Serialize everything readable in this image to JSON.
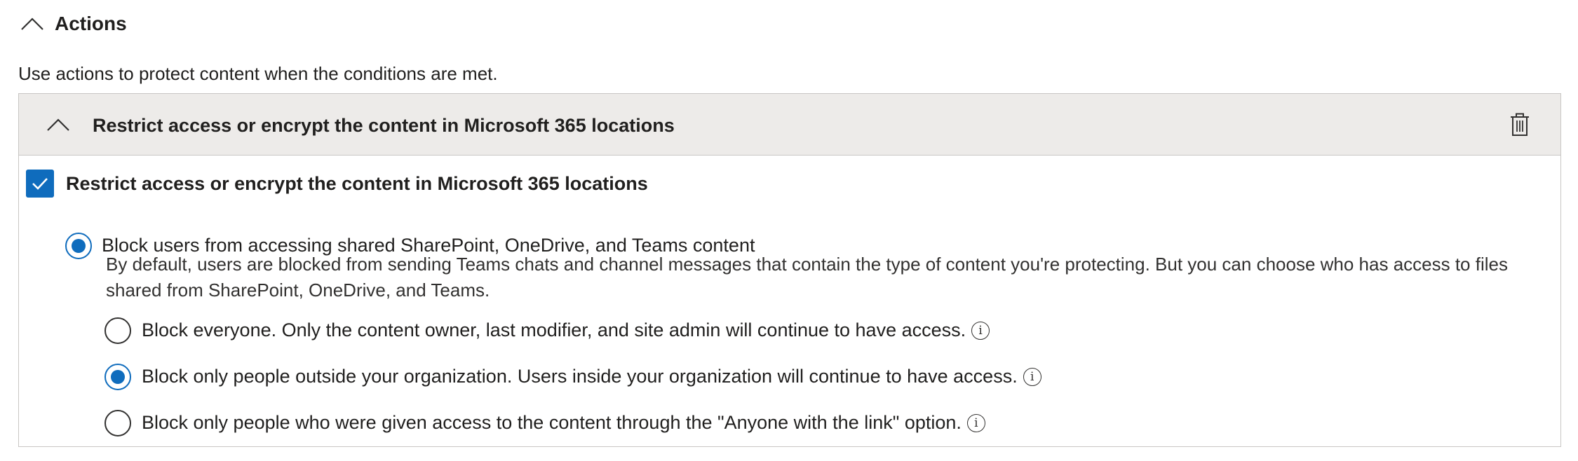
{
  "section": {
    "title": "Actions",
    "description": "Use actions to protect content when the conditions are met."
  },
  "action_panel": {
    "title": "Restrict access or encrypt the content in Microsoft 365 locations",
    "checkbox_label": "Restrict access or encrypt the content in Microsoft 365 locations",
    "checkbox_checked": true,
    "primary_option": {
      "label": "Block users from accessing shared SharePoint, OneDrive, and Teams content",
      "selected": true,
      "help_text": "By default, users are blocked from sending Teams chats and channel messages that contain the type of content you're protecting. But you can choose who has access to files shared from SharePoint, OneDrive, and Teams."
    },
    "sub_options": [
      {
        "label": "Block everyone. Only the content owner, last modifier, and site admin will continue to have access.",
        "selected": false
      },
      {
        "label": "Block only people outside your organization. Users inside your organization will continue to have access.",
        "selected": true
      },
      {
        "label": "Block only people who were given access to the content through the \"Anyone with the link\" option.",
        "selected": false
      }
    ]
  },
  "icons": {
    "collapse": "chevron-up-icon",
    "delete": "trash-icon",
    "check": "checkmark-icon",
    "info": "info-icon"
  },
  "colors": {
    "accent": "#0f6cbd",
    "header_bg": "#edebe9",
    "text": "#201f1e",
    "border": "#c8c6c4"
  }
}
